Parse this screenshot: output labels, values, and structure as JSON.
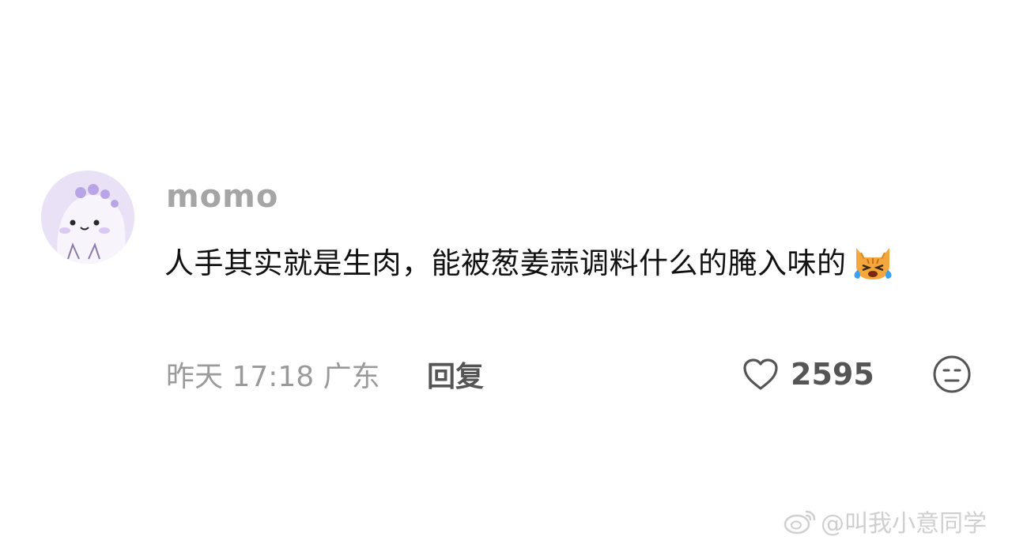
{
  "comment": {
    "username": "momo",
    "text": "人手其实就是生肉，能被葱姜蒜调料什么的腌入味的",
    "reaction_emoji": "crying-cat-emoji",
    "time_location": "昨天 17:18 广东",
    "reply_label": "回复",
    "like_count": "2595",
    "like_icon": "heart-outline-icon",
    "dislike_icon": "neutral-face-icon"
  },
  "watermark": {
    "text": "@叫我小意同学",
    "logo": "weibo-logo"
  },
  "colors": {
    "username": "#a5a5a5",
    "body_text": "#111111",
    "meta": "#9a9a9a",
    "action": "#555555",
    "avatar_bg": "#e9e2f7"
  }
}
